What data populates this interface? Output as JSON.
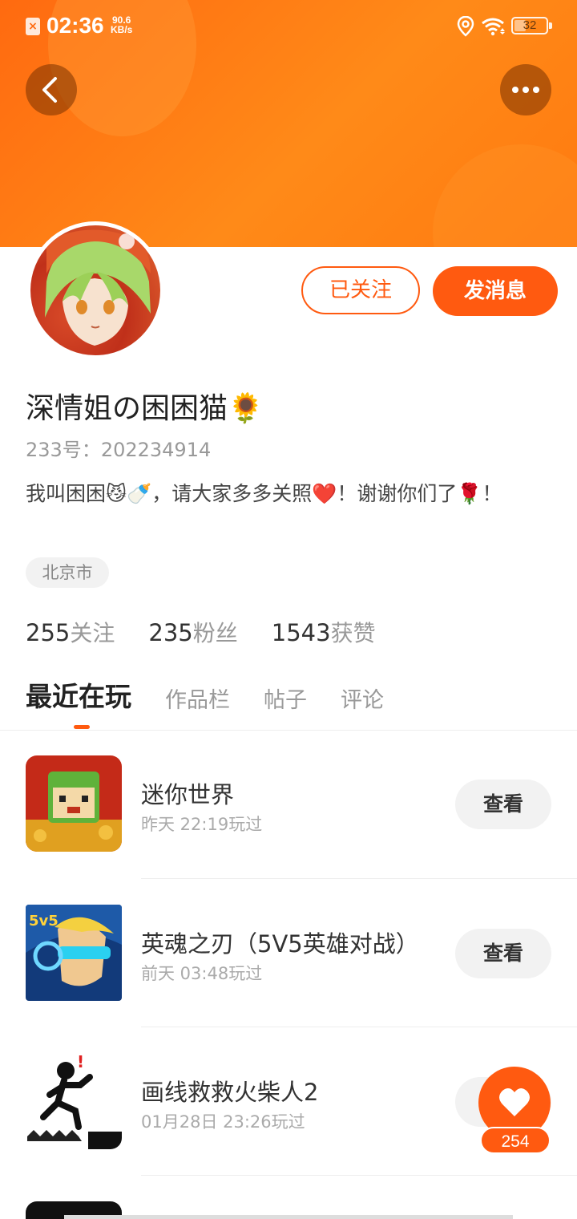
{
  "status_bar": {
    "time": "02:36",
    "net_speed_value": "90.6",
    "net_speed_unit": "KB/s",
    "battery": "32"
  },
  "header": {
    "back_icon": "chevron-left-icon",
    "more_icon": "more-dots-icon",
    "accent_color": "#ff5a10"
  },
  "profile": {
    "follow_button": "已关注",
    "message_button": "发消息",
    "username": "深情姐の困困猫🌻",
    "id_label": "233号：",
    "id_value": "202234914",
    "bio": "我叫困困😼🍼，请大家多多关照❤️！谢谢你们了🌹！",
    "location": "北京市"
  },
  "stats": [
    {
      "value": "255",
      "label": "关注"
    },
    {
      "value": "235",
      "label": "粉丝"
    },
    {
      "value": "1543",
      "label": "获赞"
    }
  ],
  "tabs": [
    {
      "label": "最近在玩",
      "active": true
    },
    {
      "label": "作品栏",
      "active": false
    },
    {
      "label": "帖子",
      "active": false
    },
    {
      "label": "评论",
      "active": false
    }
  ],
  "games": [
    {
      "title": "迷你世界",
      "played": "昨天 22:19玩过",
      "button": "查看"
    },
    {
      "title": "英魂之刃（5V5英雄对战）",
      "played": "前天 03:48玩过",
      "button": "查看"
    },
    {
      "title": "画线救救火柴人2",
      "played": "01月28日 23:26玩过",
      "button": "查看"
    }
  ],
  "like": {
    "icon": "heart-icon",
    "count": "254"
  }
}
